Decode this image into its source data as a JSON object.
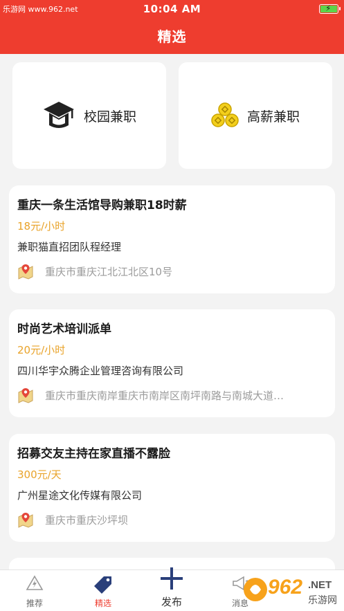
{
  "status_bar": {
    "watermark": "乐游网 www.962.net",
    "time": "10:04 AM"
  },
  "header": {
    "title": "精选"
  },
  "categories": [
    {
      "label": "校园兼职",
      "icon": "graduation-cap-icon"
    },
    {
      "label": "高薪兼职",
      "icon": "coins-icon"
    }
  ],
  "jobs": [
    {
      "title": "重庆一条生活馆导购兼职18时薪",
      "pay": "18元/小时",
      "company": "兼职猫直招团队程经理",
      "address": "重庆市重庆江北江北区10号"
    },
    {
      "title": "时尚艺术培训派单",
      "pay": "20元/小时",
      "company": "四川华宇众腾企业管理咨询有限公司",
      "address": "重庆市重庆南岸重庆市南岸区南坪南路与南城大道…"
    },
    {
      "title": "招募交友主持在家直播不露脸",
      "pay": "300元/天",
      "company": "广州星途文化传媒有限公司",
      "address": "重庆市重庆沙坪坝"
    }
  ],
  "tabbar": {
    "tabs": [
      {
        "label": "推荐"
      },
      {
        "label": "精选"
      },
      {
        "label": "发布"
      },
      {
        "label": "消息"
      }
    ]
  },
  "watermark_logo": {
    "text": "962",
    "sub": ".NET",
    "caption": "乐游网"
  },
  "colors": {
    "brand": "#ee3d2f",
    "pay": "#e9a32a",
    "accent_blue": "#2a3f7a"
  }
}
